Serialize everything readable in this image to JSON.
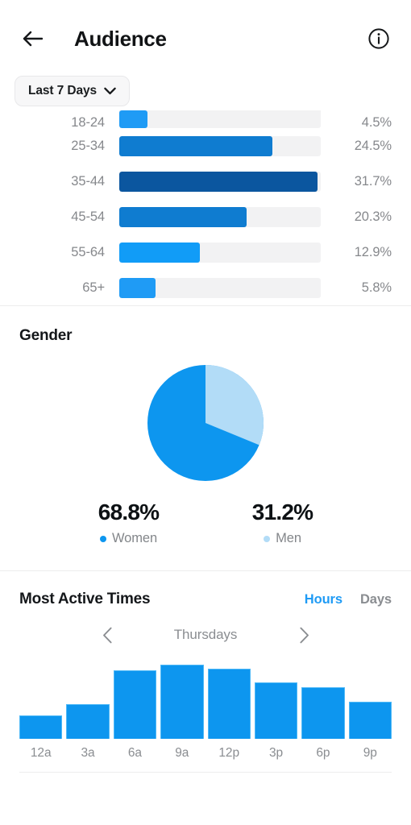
{
  "header": {
    "title": "Audience",
    "back_icon": "arrow-left-icon",
    "info_icon": "info-circle-icon"
  },
  "filter": {
    "label": "Last 7 Days",
    "chevron_icon": "chevron-down-icon"
  },
  "age_section": {
    "rows": [
      {
        "label": "18-24",
        "percent": "4.5%",
        "value": 4.5,
        "color": "#1f9bf5",
        "clipped": true
      },
      {
        "label": "25-34",
        "percent": "24.5%",
        "value": 24.5,
        "color": "#0f7cd0",
        "clipped": false
      },
      {
        "label": "35-44",
        "percent": "31.7%",
        "value": 31.7,
        "color": "#0b569f",
        "clipped": false
      },
      {
        "label": "45-54",
        "percent": "20.3%",
        "value": 20.3,
        "color": "#0f7cd0",
        "clipped": false
      },
      {
        "label": "55-64",
        "percent": "12.9%",
        "value": 12.9,
        "color": "#119cf7",
        "clipped": false
      },
      {
        "label": "65+",
        "percent": "5.8%",
        "value": 5.8,
        "color": "#1f9bf5",
        "clipped": false
      }
    ],
    "track_color": "#f2f2f3",
    "max_value": 31.7
  },
  "gender": {
    "title": "Gender",
    "women": {
      "percent": "68.8%",
      "label": "Women",
      "value": 68.8,
      "color": "#0d96ef"
    },
    "men": {
      "percent": "31.2%",
      "label": "Men",
      "value": 31.2,
      "color": "#b2dcf7"
    }
  },
  "most_active_times": {
    "title": "Most Active Times",
    "tabs": [
      {
        "label": "Hours",
        "active": true
      },
      {
        "label": "Days",
        "active": false
      }
    ],
    "day": "Thursdays",
    "prev_icon": "chevron-left-icon",
    "next_icon": "chevron-right-icon"
  },
  "chart_data": [
    {
      "type": "bar",
      "orientation": "horizontal",
      "title": "Age Range",
      "categories": [
        "18-24",
        "25-34",
        "35-44",
        "45-54",
        "55-64",
        "65+"
      ],
      "values": [
        4.5,
        24.5,
        31.7,
        20.3,
        12.9,
        5.8
      ],
      "value_labels": [
        "4.5%",
        "24.5%",
        "31.7%",
        "20.3%",
        "12.9%",
        "5.8%"
      ],
      "xlabel": "",
      "ylabel": "",
      "xlim": [
        0,
        100
      ],
      "grid": false,
      "legend": "none",
      "note": "Top row (18-24) is clipped by the scroll viewport"
    },
    {
      "type": "pie",
      "title": "Gender",
      "categories": [
        "Women",
        "Men"
      ],
      "values": [
        68.8,
        31.2
      ],
      "value_labels": [
        "68.8%",
        "31.2%"
      ],
      "colors": [
        "#0d96ef",
        "#b2dcf7"
      ],
      "legend": "bottom",
      "start_angle_deg": 0,
      "direction": "clockwise"
    },
    {
      "type": "bar",
      "orientation": "vertical",
      "title": "Most Active Times",
      "subtitle": "Thursdays",
      "categories": [
        "12a",
        "3a",
        "6a",
        "9a",
        "12p",
        "3p",
        "6p",
        "9p"
      ],
      "values": [
        31,
        47,
        92,
        100,
        95,
        76,
        70,
        50
      ],
      "xlabel": "",
      "ylabel": "",
      "ylim": [
        0,
        100
      ],
      "grid": false,
      "legend": "none"
    }
  ]
}
